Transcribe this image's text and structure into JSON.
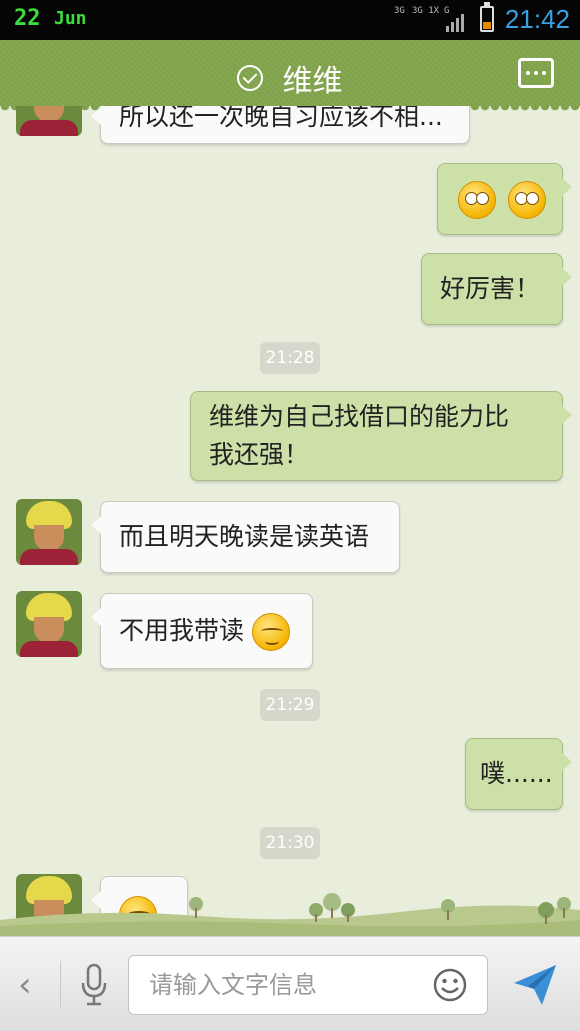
{
  "status_bar": {
    "date": "22",
    "month": "Jun",
    "network_1": "3G",
    "network_2": "3G 1X",
    "network_3": "G",
    "time": "21:42"
  },
  "header": {
    "title": "维维",
    "verified_icon": "check-circle-icon",
    "more_icon": "more-dots-icon"
  },
  "messages": [
    {
      "side": "in",
      "text": "所以还一次晚自习应该不相..."
    },
    {
      "side": "out",
      "text": "",
      "emoji": "staring-eyes-emoji x2"
    },
    {
      "side": "out",
      "text": "好厉害！"
    },
    {
      "timestamp": "21:28"
    },
    {
      "side": "out",
      "text": "维维为自己找借口的能力比",
      "text2": "我还强！"
    },
    {
      "side": "in",
      "text": "而且明天晚读是读英语"
    },
    {
      "side": "in",
      "text": "不用我带读"
    },
    {
      "timestamp": "21:29"
    },
    {
      "side": "out",
      "text": "噗......"
    },
    {
      "timestamp": "21:30"
    },
    {
      "side": "in",
      "text": "",
      "emoji": "smug-emoji"
    }
  ],
  "input_bar": {
    "placeholder": "请输入文字信息",
    "back_icon": "chevron-left-icon",
    "mic_icon": "microphone-icon",
    "smiley_icon": "smiley-icon",
    "send_icon": "send-icon"
  },
  "colors": {
    "title_bar": "#80a24a",
    "outgoing_bubble": "#cde0a8",
    "incoming_bubble": "#fafafa",
    "background": "#e8eddc",
    "clock": "#3aa0e0"
  }
}
